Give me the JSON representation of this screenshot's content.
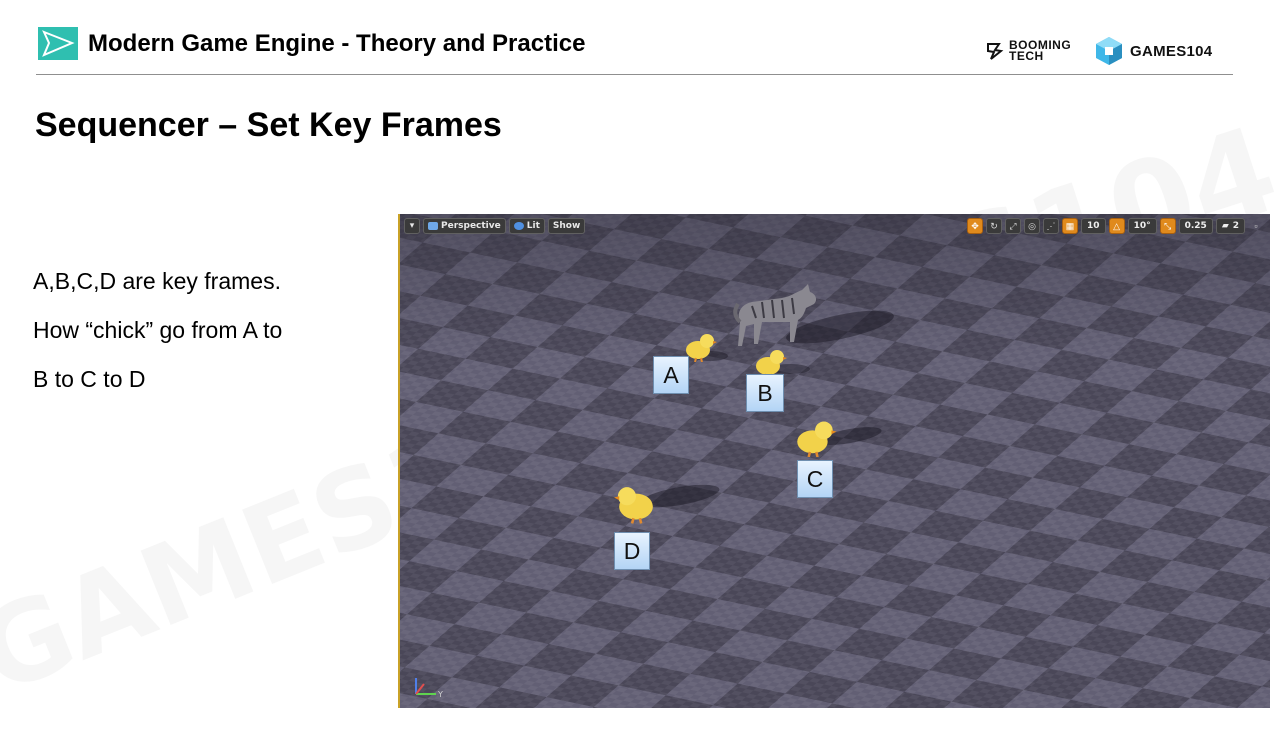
{
  "header": {
    "title": "Modern Game Engine - Theory and Practice",
    "logo_booming_line1": "BOOMING",
    "logo_booming_line2": "TECH",
    "logo_games": "GAMES104"
  },
  "slide": {
    "title": "Sequencer – Set Key Frames",
    "body_lines": [
      "A,B,C,D are key frames.",
      "How “chick” go from A to",
      "B to C to D"
    ]
  },
  "viewport": {
    "toolbar_left": {
      "perspective": "Perspective",
      "lit": "Lit",
      "show": "Show"
    },
    "toolbar_right": {
      "grid_snap": "10",
      "rotation_snap": "10°",
      "scale_snap": "0.25",
      "camera_speed": "2"
    },
    "keyframe_labels": {
      "a": "A",
      "b": "B",
      "c": "C",
      "d": "D"
    },
    "axis_label": "Y"
  },
  "colors": {
    "accent_teal": "#2fbfb0",
    "floor_dark": "#4d4a5b",
    "floor_light": "#67647a",
    "toolbar_orange": "#e08a1c"
  }
}
